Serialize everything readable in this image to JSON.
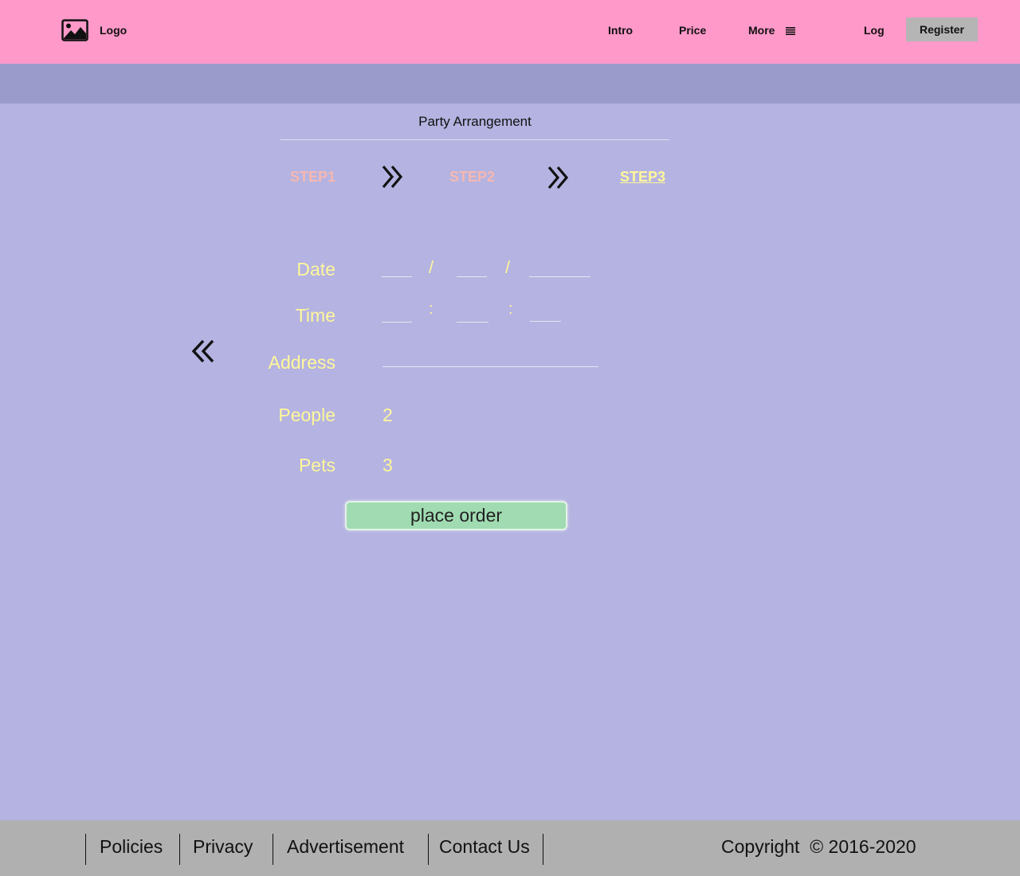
{
  "header": {
    "logo_text": "Logo",
    "nav": {
      "intro": "Intro",
      "price": "Price",
      "more": "More"
    },
    "log_label": "Log",
    "register_label": "Register"
  },
  "page": {
    "title": "Party Arrangement",
    "steps": [
      "STEP1",
      "STEP2",
      "STEP3"
    ],
    "active_step": "STEP3"
  },
  "form": {
    "date_label": "Date",
    "time_label": "Time",
    "address_label": "Address",
    "people_label": "People",
    "people_value": "2",
    "pets_label": "Pets",
    "pets_value": "3",
    "date_separator": "/",
    "time_separator": ":",
    "submit_label": "place order"
  },
  "footer": {
    "links": [
      "Policies",
      "Privacy",
      "Advertisement",
      "Contact Us"
    ],
    "copyright": "Copyright  © 2016-2020"
  },
  "colors": {
    "header_bg": "#ff99c9",
    "band_bg": "#9b9bcb",
    "page_bg": "#b4b3e1",
    "label_color": "#fff79a",
    "step_inactive": "#f7b8b0",
    "button_bg": "#a0dbb2",
    "footer_bg": "#b0b0b0"
  }
}
